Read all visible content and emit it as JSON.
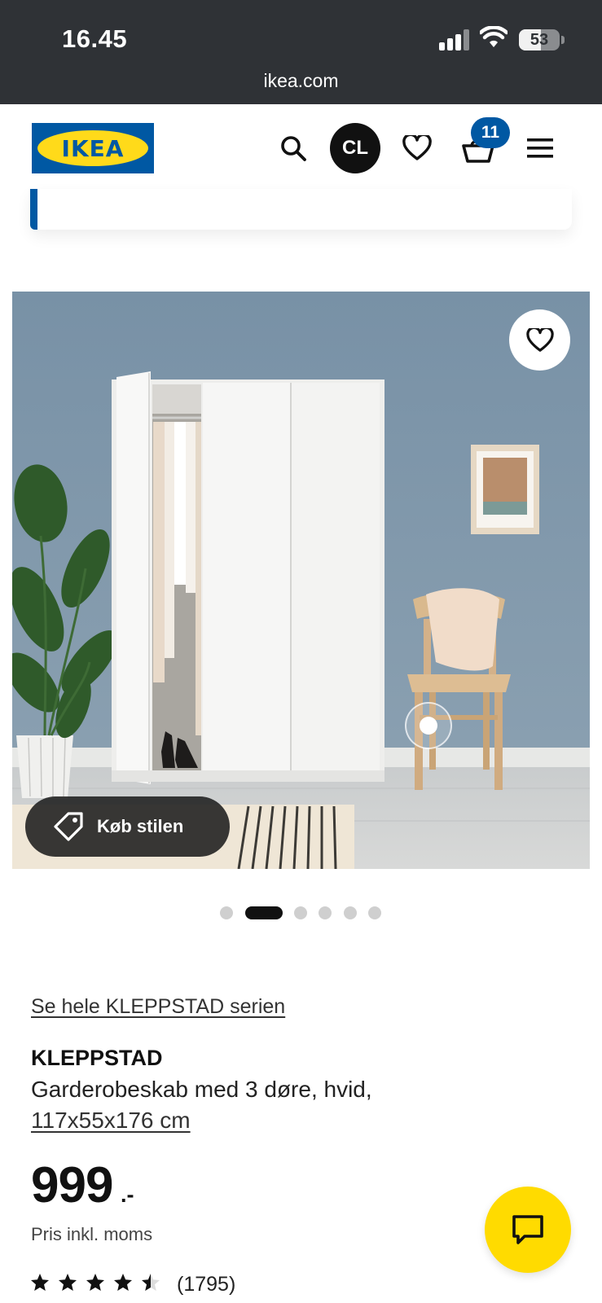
{
  "status_bar": {
    "time": "16.45",
    "battery": "53",
    "battery_level": 0.53,
    "url": "ikea.com"
  },
  "header": {
    "logo_text": "IKEA",
    "avatar_initials": "CL",
    "cart_count": "11",
    "icons": [
      "search-icon",
      "heart-icon",
      "basket-icon",
      "menu-icon"
    ]
  },
  "gallery": {
    "shop_style_label": "Køb stilen",
    "slide_count": 6,
    "active_slide": 2
  },
  "product": {
    "series_link": "Se hele KLEPPSTAD serien",
    "name": "KLEPPSTAD",
    "description": "Garderobeskab med 3 døre, hvid,",
    "size": "117x55x176 cm",
    "price": "999",
    "price_suffix": ".-",
    "price_note": "Pris inkl. moms",
    "rating": 4.5,
    "rating_max": 5,
    "review_count": "(1795)"
  },
  "colors": {
    "ikea_blue": "#0058a3",
    "ikea_yellow": "#ffda1a",
    "chat_yellow": "#ffdb00"
  }
}
